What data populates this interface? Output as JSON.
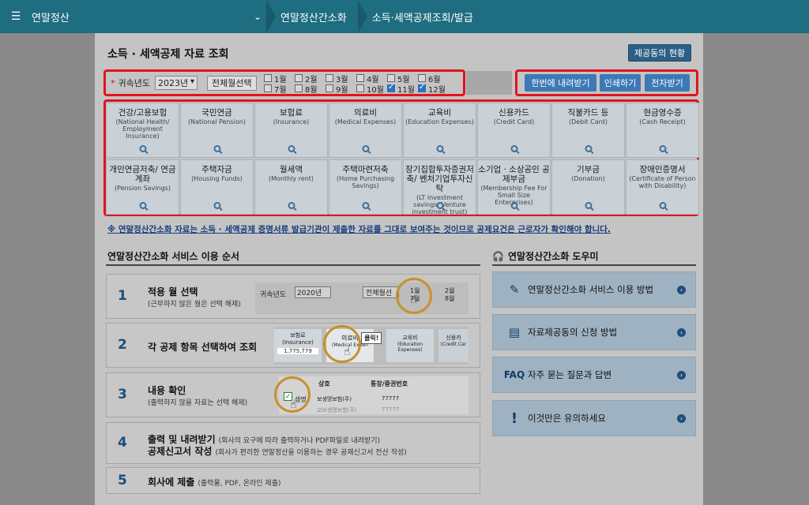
{
  "nav": {
    "menu_title": "연말정산",
    "breadcrumbs": [
      "연말정산간소화",
      "소득·세액공제조회/발급"
    ]
  },
  "page": {
    "title": "소득 · 세액공제 자료 조회",
    "status_button": "제공동의 현황"
  },
  "filter": {
    "year_label": "귀속년도",
    "year_value": "2023년",
    "select_all_label": "전체월선택",
    "months": [
      {
        "label": "1월",
        "checked": false
      },
      {
        "label": "2월",
        "checked": false
      },
      {
        "label": "3월",
        "checked": false
      },
      {
        "label": "4월",
        "checked": false
      },
      {
        "label": "5월",
        "checked": false
      },
      {
        "label": "6월",
        "checked": false
      },
      {
        "label": "7월",
        "checked": false
      },
      {
        "label": "8월",
        "checked": false
      },
      {
        "label": "9월",
        "checked": false
      },
      {
        "label": "10월",
        "checked": false
      },
      {
        "label": "11월",
        "checked": true
      },
      {
        "label": "12월",
        "checked": true
      }
    ]
  },
  "actions": {
    "download_all": "한번에 내려받기",
    "print": "인쇄하기",
    "e_submit": "전자받기"
  },
  "categories": [
    {
      "ko": "건강/고용보험",
      "en": "(National Health/ Employment Insurance)"
    },
    {
      "ko": "국민연금",
      "en": "(National Pension)"
    },
    {
      "ko": "보험료",
      "en": "(Insurance)"
    },
    {
      "ko": "의료비",
      "en": "(Medical Expenses)"
    },
    {
      "ko": "교육비",
      "en": "(Education Expenses)"
    },
    {
      "ko": "신용카드",
      "en": "(Credit Card)"
    },
    {
      "ko": "직불카드 등",
      "en": "(Debit Card)"
    },
    {
      "ko": "현금영수증",
      "en": "(Cash Receipt)"
    },
    {
      "ko": "개인연금저축/ 연금계좌",
      "en": "(Pension Savings)"
    },
    {
      "ko": "주택자금",
      "en": "(Housing Funds)"
    },
    {
      "ko": "월세액",
      "en": "(Monthly rent)"
    },
    {
      "ko": "주택마련저축",
      "en": "(Home Purchasing Savings)"
    },
    {
      "ko": "장기집합투자증권저축/ 벤처기업투자신탁",
      "en": "(LT investment savings/ Venture investment trust)"
    },
    {
      "ko": "소기업 · 소상공인 공제부금",
      "en": "(Membership Fee For Small Size Enterprises)"
    },
    {
      "ko": "기부금",
      "en": "(Donation)"
    },
    {
      "ko": "장애인증명서",
      "en": "(Certificate of Person with Disability)"
    }
  ],
  "notice": "※ 연말정산간소화 자료는 소득 · 세액공제 증명서류 발급기관이 제출한 자료를 그대로 보여주는 것이므로 공제요건은 근로자가 확인해야 합니다.",
  "steps_section": {
    "title": "연말정산간소화 서비스 이용 순서",
    "steps": [
      {
        "num": "1",
        "title": "적용 월 선택",
        "sub": "(근무하지 않은 월은 선택 해제)"
      },
      {
        "num": "2",
        "title": "각 공제 항목 선택하여 조회",
        "sub": ""
      },
      {
        "num": "3",
        "title": "내용 확인",
        "sub": "(출력하지 않을 자료는 선택 해제)"
      },
      {
        "num": "4",
        "title": "출력 및 내려받기",
        "title2": "공제신고서 작성",
        "sub": "(회사의 요구에 따라 출력하거나 PDF파일로 내려받기)",
        "sub2": "(회사가 편리한 연말정산을 이용하는 경우 공제신고서 전산 작성)"
      },
      {
        "num": "5",
        "title": "회사에 제출",
        "sub": "(출력물, PDF, 온라인 제출)"
      }
    ],
    "illus1": {
      "year_label": "귀속년도",
      "year_value": "2020년",
      "btn": "전체월선",
      "m1": "1월",
      "m2": "2월",
      "m7": "7월",
      "m8": "8월"
    },
    "illus2": {
      "c1": "보험료",
      "c1en": "(Insurance)",
      "c1val": "1,775,779",
      "c2": "의료비",
      "c2en": "(Medical Expen",
      "click": "클릭!",
      "c3": "교육비",
      "c3en": "(Education Expenses)",
      "c4": "신용카",
      "c4en": "(Credit Car"
    },
    "illus3": {
      "h1": "상호",
      "h2": "통장/증권번호",
      "r1a": "생명",
      "r1b": "보생명보험(주)",
      "r1c": "77777",
      "r2b": "교보생명보험(주)",
      "r2c": "77777"
    }
  },
  "help_section": {
    "title": "연말정산간소화 도우미",
    "items": [
      {
        "icon": "document-edit-icon",
        "glyph": "✎",
        "label": "연말정산간소화 서비스 이용 방법"
      },
      {
        "icon": "document-icon",
        "glyph": "▤",
        "label": "자료제공동의 신청 방법"
      },
      {
        "icon": "faq-icon",
        "glyph": "FAQ",
        "label": "자주 묻는 질문과 답변"
      },
      {
        "icon": "exclamation-icon",
        "glyph": "!",
        "label": "이것만은 유의하세요"
      }
    ]
  }
}
